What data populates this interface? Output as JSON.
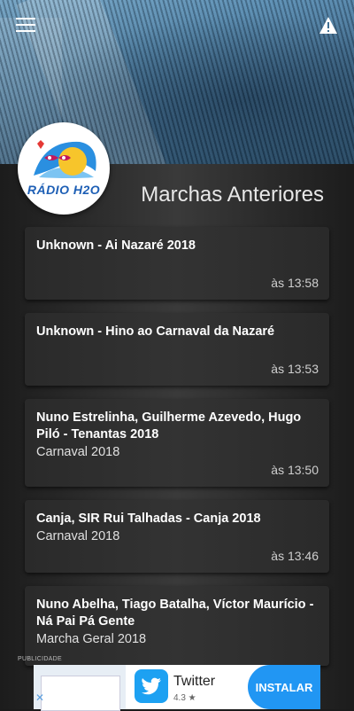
{
  "header": {
    "menu_icon": "hamburger-menu-icon",
    "alert_icon": "warning-triangle-icon",
    "logo_text": "RÁDIO H2O",
    "title": "Marchas Anteriores"
  },
  "tracks": [
    {
      "title": "Unknown - Ai Nazaré 2018",
      "album": "",
      "time": "às 13:58"
    },
    {
      "title": "Unknown - Hino ao Carnaval da Nazaré",
      "album": "",
      "time": "às 13:53"
    },
    {
      "title": "Nuno Estrelinha, Guilherme Azevedo, Hugo Piló - Tenantas 2018",
      "album": "Carnaval 2018",
      "time": "às 13:50"
    },
    {
      "title": "Canja, SIR Rui Talhadas - Canja 2018",
      "album": "Carnaval 2018",
      "time": "às 13:46"
    },
    {
      "title": "Nuno Abelha, Tiago Batalha, Víctor Maurício - Ná Pai Pá Gente",
      "album": "Marcha Geral 2018",
      "time": ""
    }
  ],
  "ad": {
    "label": "PUBLICIDADE",
    "app_name": "Twitter",
    "rating": "4.3 ★",
    "install_label": "INSTALAR"
  },
  "colors": {
    "accent": "#2196f3",
    "twitter": "#1da1f2",
    "logo_blue": "#1e5fb5"
  }
}
